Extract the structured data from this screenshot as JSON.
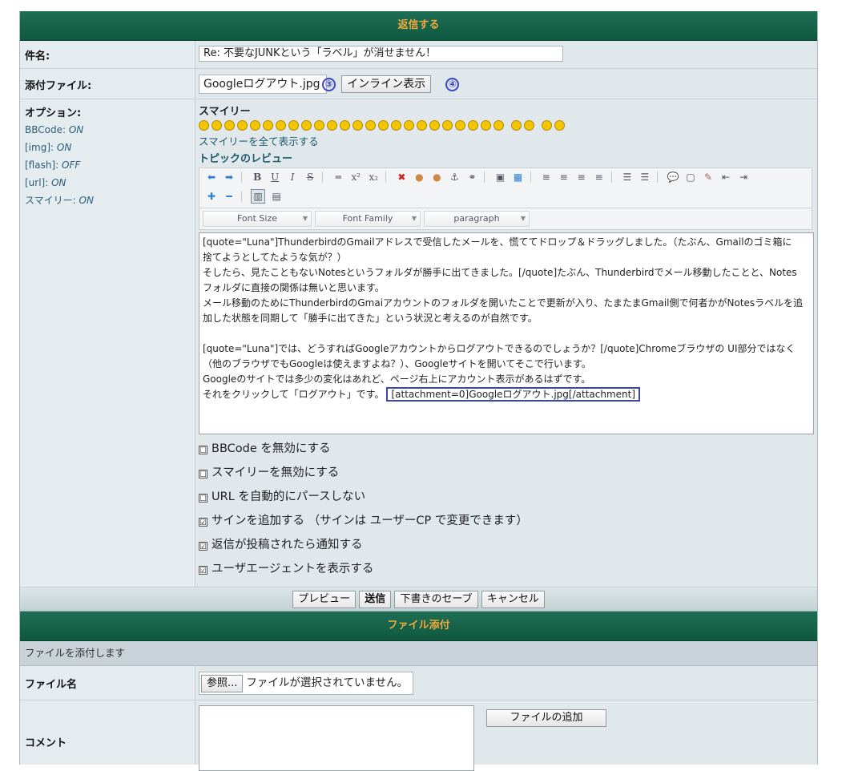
{
  "reply": {
    "header": "返信する",
    "subject_label": "件名:",
    "subject_value": "Re: 不要なJUNKという「ラベル」が消せません！",
    "attach_label": "添付ファイル:",
    "attach_file": "Googleログアウト.jpg",
    "marker3": "③",
    "inline_button": "インライン表示",
    "marker4": "④",
    "options_label": "オプション:",
    "options": [
      {
        "name": "BBCode:",
        "value": "ON"
      },
      {
        "name": "[img]:",
        "value": "ON"
      },
      {
        "name": "[flash]:",
        "value": "OFF"
      },
      {
        "name": "[url]:",
        "value": "ON"
      },
      {
        "name": "スマイリー:",
        "value": "ON"
      }
    ],
    "smilies_label": "スマイリー",
    "smilies_show_all": "スマイリーを全て表示する",
    "topic_review": "トピックのレビュー",
    "font_size": "Font Size",
    "font_family": "Font Family",
    "paragraph": "paragraph",
    "editor_lines": [
      "[quote=\"Luna\"]ThunderbirdのGmailアドレスで受信したメールを、慌ててドロップ＆ドラッグしました。（たぶん、Gmailのゴミ箱に",
      "捨てようとしてたような気が？）",
      "そしたら、見たこともないNotesというフォルダが勝手に出てきました。[/quote]たぶん、Thunderbirdでメール移動したことと、Notes",
      "フォルダに直接の関係は無いと思います。",
      "メール移動のためにThunderbirdのGmaiアカウントのフォルダを開いたことで更新が入り、たまたまGmail側で何者かがNotesラベルを追",
      "加した状態を同期して「勝手に出てきた」という状況と考えるのが自然です。",
      "",
      "[quote=\"Luna\"]では、どうすればGoogleアカウントからログアウトできるのでしょうか？[/quote]Chromeブラウザの UI部分ではなく",
      "（他のブラウザでもGoogleは使えますよね？）、Googleサイトを開いてそこで行います。",
      "Googleのサイトでは多少の変化はあれど、ページ右上にアカウント表示があるはずです。"
    ],
    "editor_last_line": "それをクリックして「ログアウト」です。",
    "editor_attachment": "[attachment=0]Googleログアウト.jpg[/attachment]",
    "checkboxes": [
      {
        "label": "BBCode を無効にする",
        "checked": "☐"
      },
      {
        "label": "スマイリーを無効にする",
        "checked": "☐"
      },
      {
        "label": "URL を自動的にパースしない",
        "checked": "☐"
      },
      {
        "label": "サインを追加する （サインは ユーザーCP で変更できます）",
        "checked": "☑"
      },
      {
        "label": "返信が投稿されたら通知する",
        "checked": "☑"
      },
      {
        "label": "ユーザエージェントを表示する",
        "checked": "☑"
      }
    ],
    "buttons": {
      "preview": "プレビュー",
      "send": "送信",
      "save_draft": "下書きのセーブ",
      "cancel": "キャンセル"
    }
  },
  "attach": {
    "header": "ファイル添付",
    "subheader": "ファイルを添付します",
    "filename_label": "ファイル名",
    "browse_button": "参照...",
    "no_file": "ファイルが選択されていません。",
    "comment_label": "コメント",
    "add_file_button": "ファイルの追加"
  }
}
